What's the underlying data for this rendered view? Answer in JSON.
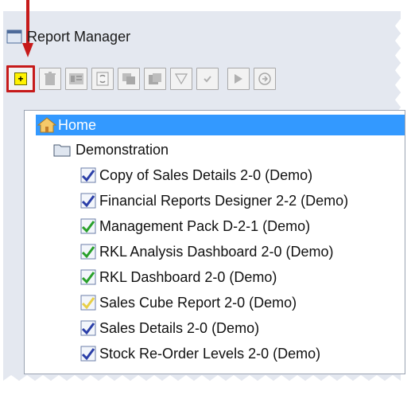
{
  "window": {
    "title": "Report Manager"
  },
  "toolbar": {
    "buttons": [
      {
        "icon": "new-report-icon",
        "highlighted": true
      },
      {
        "icon": "delete-icon"
      },
      {
        "icon": "properties-icon"
      },
      {
        "icon": "refresh-icon"
      },
      {
        "icon": "copy-icon"
      },
      {
        "icon": "paste-icon"
      },
      {
        "icon": "filter-icon"
      },
      {
        "icon": "check-icon"
      },
      {
        "icon": "run-icon"
      },
      {
        "icon": "export-icon"
      }
    ],
    "highlight_color": "#c61a1a"
  },
  "tree": {
    "home": {
      "label": "Home",
      "selected": true,
      "selection_color": "#3399ff"
    },
    "folder": {
      "label": "Demonstration"
    },
    "reports": [
      {
        "label": "Copy of Sales Details 2-0 (Demo)",
        "icon": "blue-check-icon"
      },
      {
        "label": "Financial Reports Designer 2-2 (Demo)",
        "icon": "blue-check-icon"
      },
      {
        "label": "Management Pack D-2-1 (Demo)",
        "icon": "green-check-icon"
      },
      {
        "label": "RKL Analysis Dashboard 2-0 (Demo)",
        "icon": "green-check-icon"
      },
      {
        "label": "RKL Dashboard 2-0 (Demo)",
        "icon": "green-check-icon"
      },
      {
        "label": "Sales Cube Report 2-0 (Demo)",
        "icon": "yellow-check-icon"
      },
      {
        "label": "Sales Details 2-0 (Demo)",
        "icon": "blue-check-icon"
      },
      {
        "label": "Stock Re-Order Levels 2-0 (Demo)",
        "icon": "blue-check-icon"
      }
    ]
  },
  "annotation": {
    "arrow_color": "#c61a1a"
  }
}
